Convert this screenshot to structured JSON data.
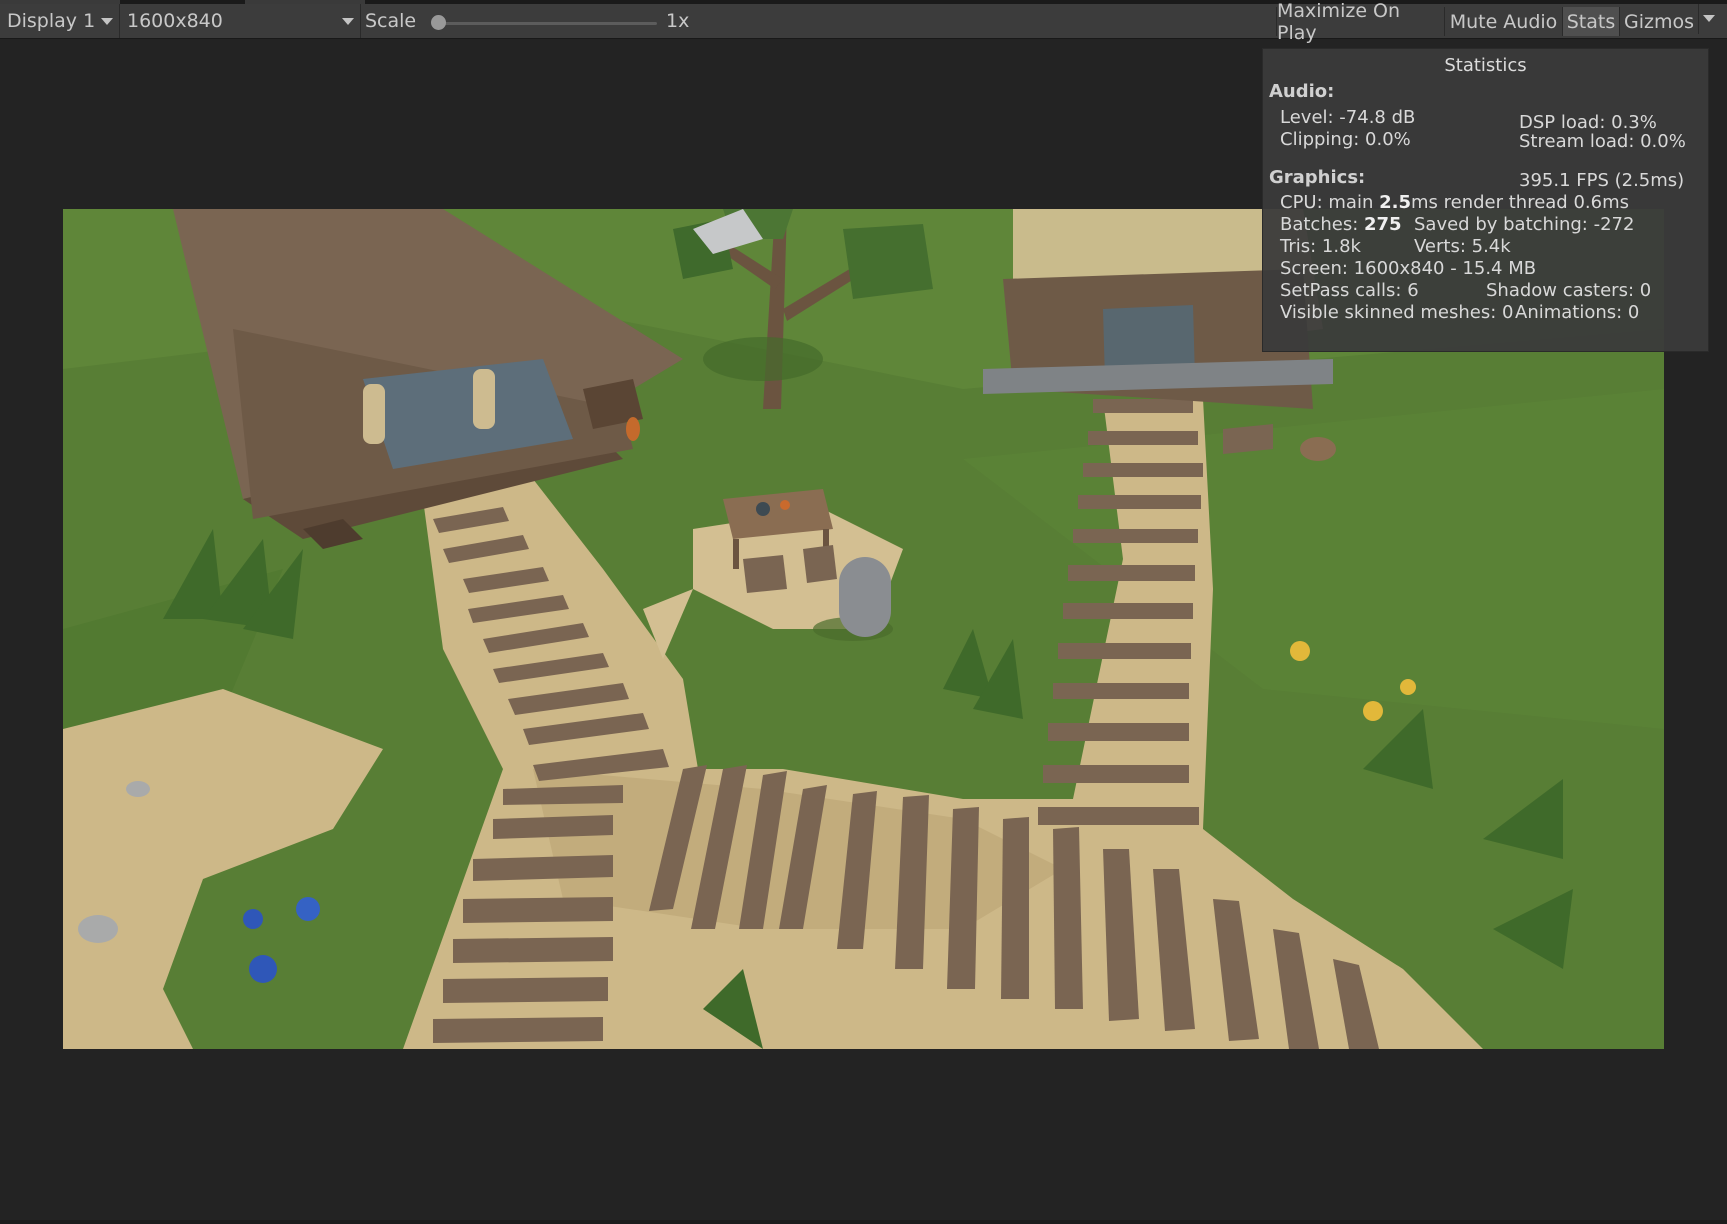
{
  "toolbar": {
    "display": "Display 1",
    "resolution": "1600x840",
    "scale_label": "Scale",
    "scale_value": "1x",
    "scale_fraction": 0.0,
    "buttons": {
      "maximize": "Maximize On Play",
      "mute": "Mute Audio",
      "stats": "Stats",
      "gizmos": "Gizmos"
    }
  },
  "stats": {
    "title": "Statistics",
    "audio": {
      "heading": "Audio:",
      "level": "Level: -74.8 dB",
      "clipping": "Clipping: 0.0%",
      "dsp_load": "DSP load: 0.3%",
      "stream_load": "Stream load: 0.0%"
    },
    "graphics": {
      "heading": "Graphics:",
      "fps": "395.1 FPS (2.5ms)",
      "cpu_prefix": "CPU: main ",
      "cpu_main": "2.5",
      "cpu_suffix": "ms  render thread 0.6ms",
      "batches_prefix": "Batches: ",
      "batches": "275",
      "saved": "Saved by batching: -272",
      "tris": "Tris: 1.8k",
      "verts": "Verts: 5.4k",
      "screen": "Screen: 1600x840 - 15.4 MB",
      "setpass": "SetPass calls: 6",
      "shadow": "Shadow casters: 0",
      "skinned": "Visible skinned meshes: 0",
      "animations": "Animations: 0"
    }
  },
  "colors": {
    "grass": "#587e35",
    "path": "#cdb888",
    "plank": "#7a6552",
    "wood_dark": "#5e4a39",
    "capsule": "#8a8d91"
  }
}
